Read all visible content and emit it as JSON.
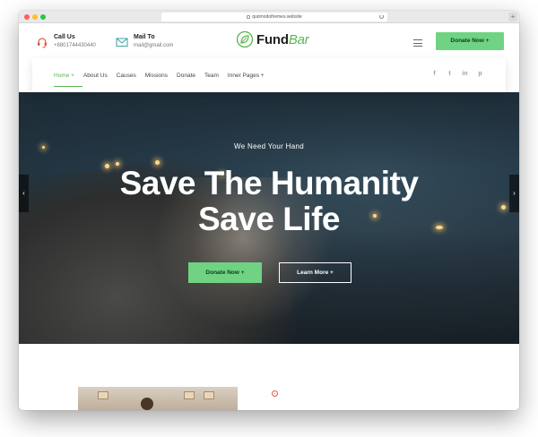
{
  "browser": {
    "url": "quomodothemes.website"
  },
  "header": {
    "call": {
      "title": "Call Us",
      "value": "+8801744430440",
      "icon": "headset-icon"
    },
    "mail": {
      "title": "Mail To",
      "value": "mail@gmail.com",
      "icon": "envelope-icon"
    },
    "logo": {
      "text_main": "Fund",
      "text_accent": "Bar",
      "icon": "leaf-icon"
    },
    "donate_label": "Donate Now +"
  },
  "nav": {
    "items": [
      {
        "label": "Home +",
        "active": true
      },
      {
        "label": "About Us"
      },
      {
        "label": "Causes"
      },
      {
        "label": "Missions"
      },
      {
        "label": "Donate"
      },
      {
        "label": "Team"
      },
      {
        "label": "Inner Pages +"
      }
    ],
    "socials": [
      {
        "name": "facebook-icon",
        "glyph": "f"
      },
      {
        "name": "twitter-icon",
        "glyph": "t"
      },
      {
        "name": "linkedin-icon",
        "glyph": "in"
      },
      {
        "name": "pinterest-icon",
        "glyph": "p"
      }
    ]
  },
  "hero": {
    "subtitle": "We Need Your Hand",
    "title_line1": "Save The Humanity",
    "title_line2": "Save Life",
    "donate_label": "Donate Now +",
    "learn_label": "Learn More +",
    "prev_arrow": "‹",
    "next_arrow": "›"
  },
  "colors": {
    "accent": "#6fd383",
    "brand_green": "#58b64f",
    "icon_red": "#e0584b",
    "mail_icon": "#3aa3a0"
  }
}
